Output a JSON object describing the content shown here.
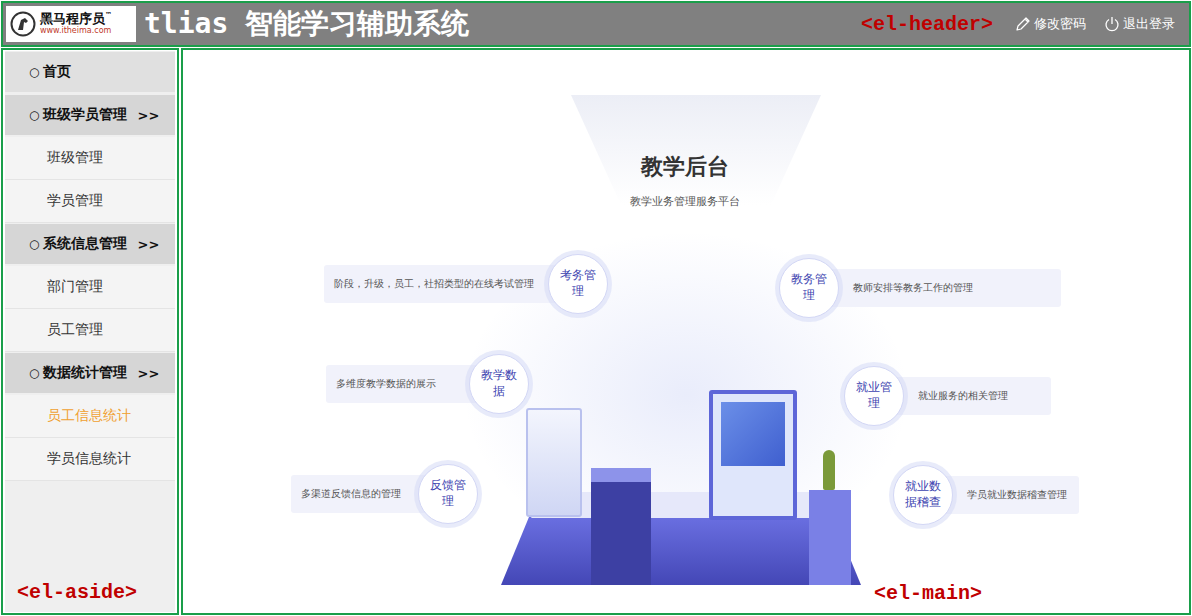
{
  "annotations": {
    "header": "<el-header>",
    "aside": "<el-aside>",
    "main": "<el-main>"
  },
  "header": {
    "logo": {
      "name": "黑马程序员",
      "tm": "™",
      "url": "www.itheima.com"
    },
    "title": "tlias 智能学习辅助系统",
    "actions": [
      {
        "label": "修改密码",
        "kind": "edit"
      },
      {
        "label": "退出登录",
        "kind": "logout"
      }
    ]
  },
  "sidebar": {
    "items": [
      {
        "kind": "link",
        "bullet": "○",
        "label": "首页",
        "selected": false
      },
      {
        "kind": "group",
        "bullet": "○",
        "label": "班级学员管理",
        "arrow": ">>",
        "expanded": true,
        "selected": false,
        "children": [
          {
            "label": "班级管理",
            "selected": false
          },
          {
            "label": "学员管理",
            "selected": false
          }
        ]
      },
      {
        "kind": "group",
        "bullet": "○",
        "label": "系统信息管理",
        "arrow": ">>",
        "expanded": true,
        "selected": false,
        "children": [
          {
            "label": "部门管理",
            "selected": false
          },
          {
            "label": "员工管理",
            "selected": false
          }
        ]
      },
      {
        "kind": "group",
        "bullet": "○",
        "label": "数据统计管理",
        "arrow": ">>",
        "expanded": true,
        "selected": false,
        "children": [
          {
            "label": "员工信息统计",
            "selected": true
          },
          {
            "label": "学员信息统计",
            "selected": false
          }
        ]
      }
    ]
  },
  "main": {
    "title": "教学后台",
    "subtitle": "教学业务管理服务平台",
    "modules": [
      {
        "name": "考务管理",
        "description": "阶段，升级，员工，社招类型的在线考试管理"
      },
      {
        "name": "教学数据",
        "description": "多维度教学数据的展示"
      },
      {
        "name": "反馈管理",
        "description": "多渠道反馈信息的管理"
      },
      {
        "name": "教务管理",
        "description": "教师安排等教务工作的管理"
      },
      {
        "name": "就业管理",
        "description": "就业服务的相关管理"
      },
      {
        "name": "就业数据稽查",
        "description": "学员就业数据稽查管理"
      }
    ]
  }
}
